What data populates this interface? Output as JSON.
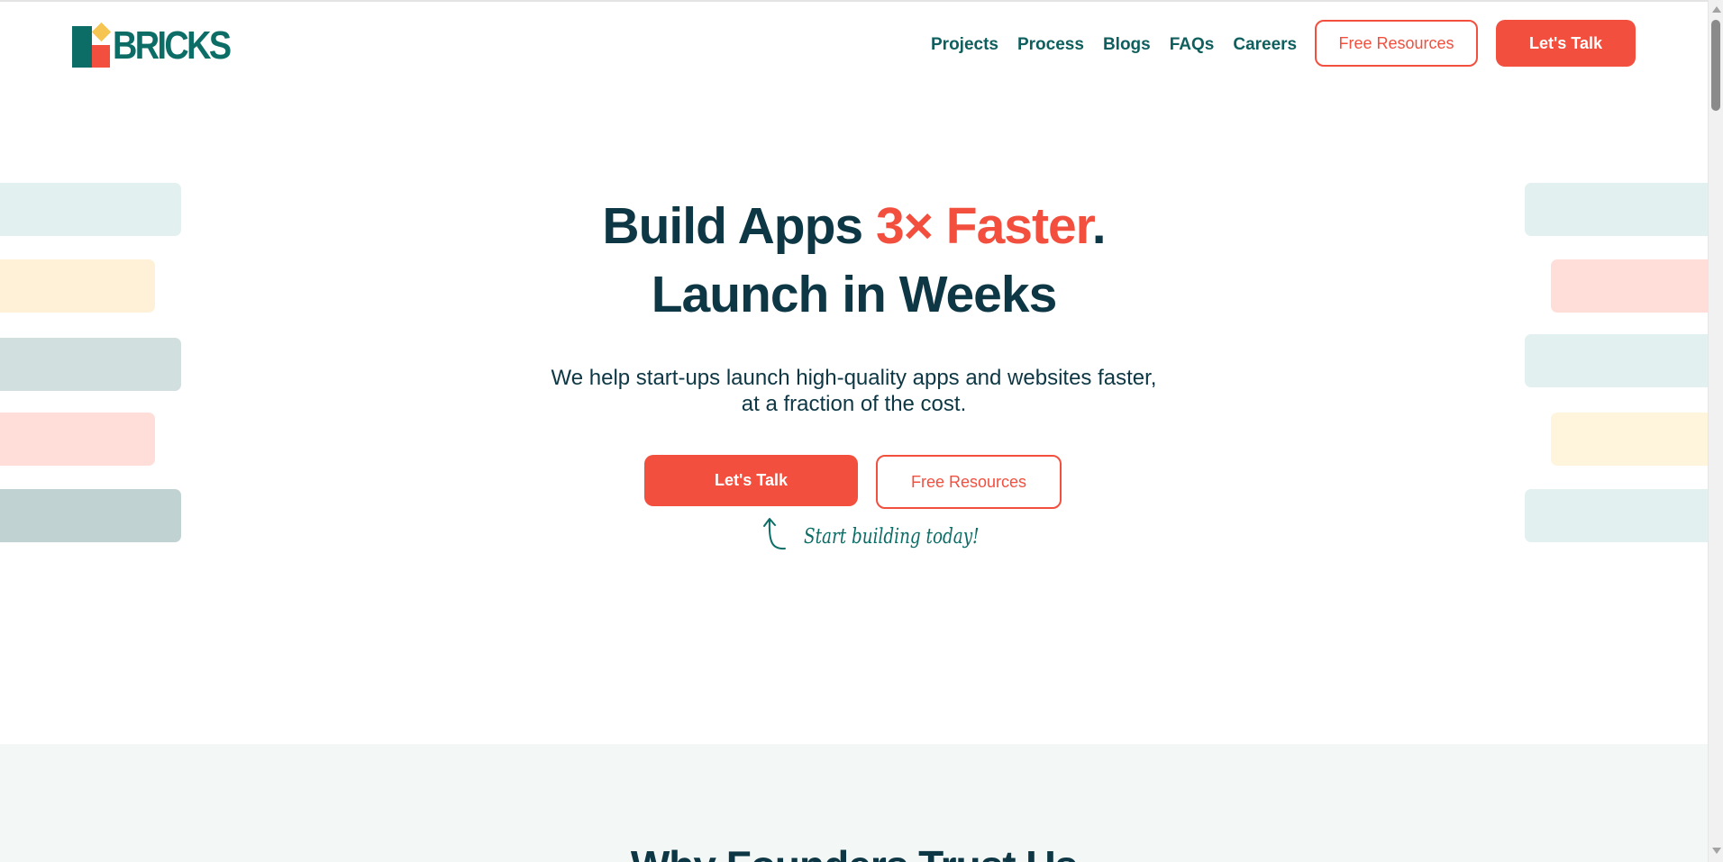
{
  "brand": {
    "name": "BRICKS"
  },
  "nav": {
    "items": [
      "Projects",
      "Process",
      "Blogs",
      "FAQs",
      "Careers"
    ],
    "free_resources_label": "Free Resources",
    "lets_talk_label": "Let's Talk"
  },
  "hero": {
    "title_part1": "Build Apps ",
    "title_accent": "3× Faster",
    "title_part2": ".",
    "title_line2": "Launch in Weeks",
    "subtitle_line1": "We help start-ups launch high-quality apps and websites faster,",
    "subtitle_line2": "at a fraction of the cost.",
    "primary_cta": "Let's Talk",
    "secondary_cta": "Free Resources",
    "handwritten_note": "Start building today!"
  },
  "section2": {
    "heading": "Why Founders Trust Us"
  },
  "colors": {
    "accent": "#f24f3e",
    "brand_teal": "#0b6d66",
    "heading": "#0d3744",
    "deco_teal_light": "#e3f0f0",
    "deco_yellow": "#fff1d8",
    "deco_gray": "#d1dfdf",
    "deco_pink": "#ffded9",
    "deco_gray_dark": "#c0d2d1"
  }
}
